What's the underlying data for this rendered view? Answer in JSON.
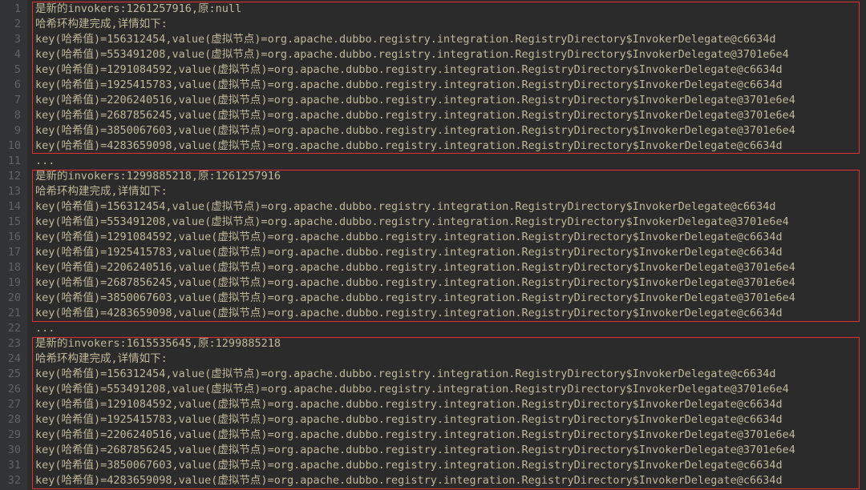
{
  "blocks": [
    {
      "header": "是新的invokers:1261257916,原:null",
      "subheader": "哈希环构建完成,详情如下:",
      "entries": [
        "key(哈希值)=156312454,value(虚拟节点)=org.apache.dubbo.registry.integration.RegistryDirectory$InvokerDelegate@c6634d",
        "key(哈希值)=553491208,value(虚拟节点)=org.apache.dubbo.registry.integration.RegistryDirectory$InvokerDelegate@3701e6e4",
        "key(哈希值)=1291084592,value(虚拟节点)=org.apache.dubbo.registry.integration.RegistryDirectory$InvokerDelegate@c6634d",
        "key(哈希值)=1925415783,value(虚拟节点)=org.apache.dubbo.registry.integration.RegistryDirectory$InvokerDelegate@c6634d",
        "key(哈希值)=2206240516,value(虚拟节点)=org.apache.dubbo.registry.integration.RegistryDirectory$InvokerDelegate@3701e6e4",
        "key(哈希值)=2687856245,value(虚拟节点)=org.apache.dubbo.registry.integration.RegistryDirectory$InvokerDelegate@3701e6e4",
        "key(哈希值)=3850067603,value(虚拟节点)=org.apache.dubbo.registry.integration.RegistryDirectory$InvokerDelegate@3701e6e4",
        "key(哈希值)=4283659098,value(虚拟节点)=org.apache.dubbo.registry.integration.RegistryDirectory$InvokerDelegate@c6634d"
      ]
    },
    {
      "header": "是新的invokers:1299885218,原:1261257916",
      "subheader": "哈希环构建完成,详情如下:",
      "entries": [
        "key(哈希值)=156312454,value(虚拟节点)=org.apache.dubbo.registry.integration.RegistryDirectory$InvokerDelegate@c6634d",
        "key(哈希值)=553491208,value(虚拟节点)=org.apache.dubbo.registry.integration.RegistryDirectory$InvokerDelegate@3701e6e4",
        "key(哈希值)=1291084592,value(虚拟节点)=org.apache.dubbo.registry.integration.RegistryDirectory$InvokerDelegate@c6634d",
        "key(哈希值)=1925415783,value(虚拟节点)=org.apache.dubbo.registry.integration.RegistryDirectory$InvokerDelegate@c6634d",
        "key(哈希值)=2206240516,value(虚拟节点)=org.apache.dubbo.registry.integration.RegistryDirectory$InvokerDelegate@3701e6e4",
        "key(哈希值)=2687856245,value(虚拟节点)=org.apache.dubbo.registry.integration.RegistryDirectory$InvokerDelegate@3701e6e4",
        "key(哈希值)=3850067603,value(虚拟节点)=org.apache.dubbo.registry.integration.RegistryDirectory$InvokerDelegate@3701e6e4",
        "key(哈希值)=4283659098,value(虚拟节点)=org.apache.dubbo.registry.integration.RegistryDirectory$InvokerDelegate@c6634d"
      ]
    },
    {
      "header": "是新的invokers:1615535645,原:1299885218",
      "subheader": "哈希环构建完成,详情如下:",
      "entries": [
        "key(哈希值)=156312454,value(虚拟节点)=org.apache.dubbo.registry.integration.RegistryDirectory$InvokerDelegate@c6634d",
        "key(哈希值)=553491208,value(虚拟节点)=org.apache.dubbo.registry.integration.RegistryDirectory$InvokerDelegate@3701e6e4",
        "key(哈希值)=1291084592,value(虚拟节点)=org.apache.dubbo.registry.integration.RegistryDirectory$InvokerDelegate@c6634d",
        "key(哈希值)=1925415783,value(虚拟节点)=org.apache.dubbo.registry.integration.RegistryDirectory$InvokerDelegate@c6634d",
        "key(哈希值)=2206240516,value(虚拟节点)=org.apache.dubbo.registry.integration.RegistryDirectory$InvokerDelegate@3701e6e4",
        "key(哈希值)=2687856245,value(虚拟节点)=org.apache.dubbo.registry.integration.RegistryDirectory$InvokerDelegate@3701e6e4",
        "key(哈希值)=3850067603,value(虚拟节点)=org.apache.dubbo.registry.integration.RegistryDirectory$InvokerDelegate@c6634d",
        "key(哈希值)=4283659098,value(虚拟节点)=org.apache.dubbo.registry.integration.RegistryDirectory$InvokerDelegate@c6634d"
      ]
    }
  ],
  "ellipsis": "...",
  "total_lines": 32
}
